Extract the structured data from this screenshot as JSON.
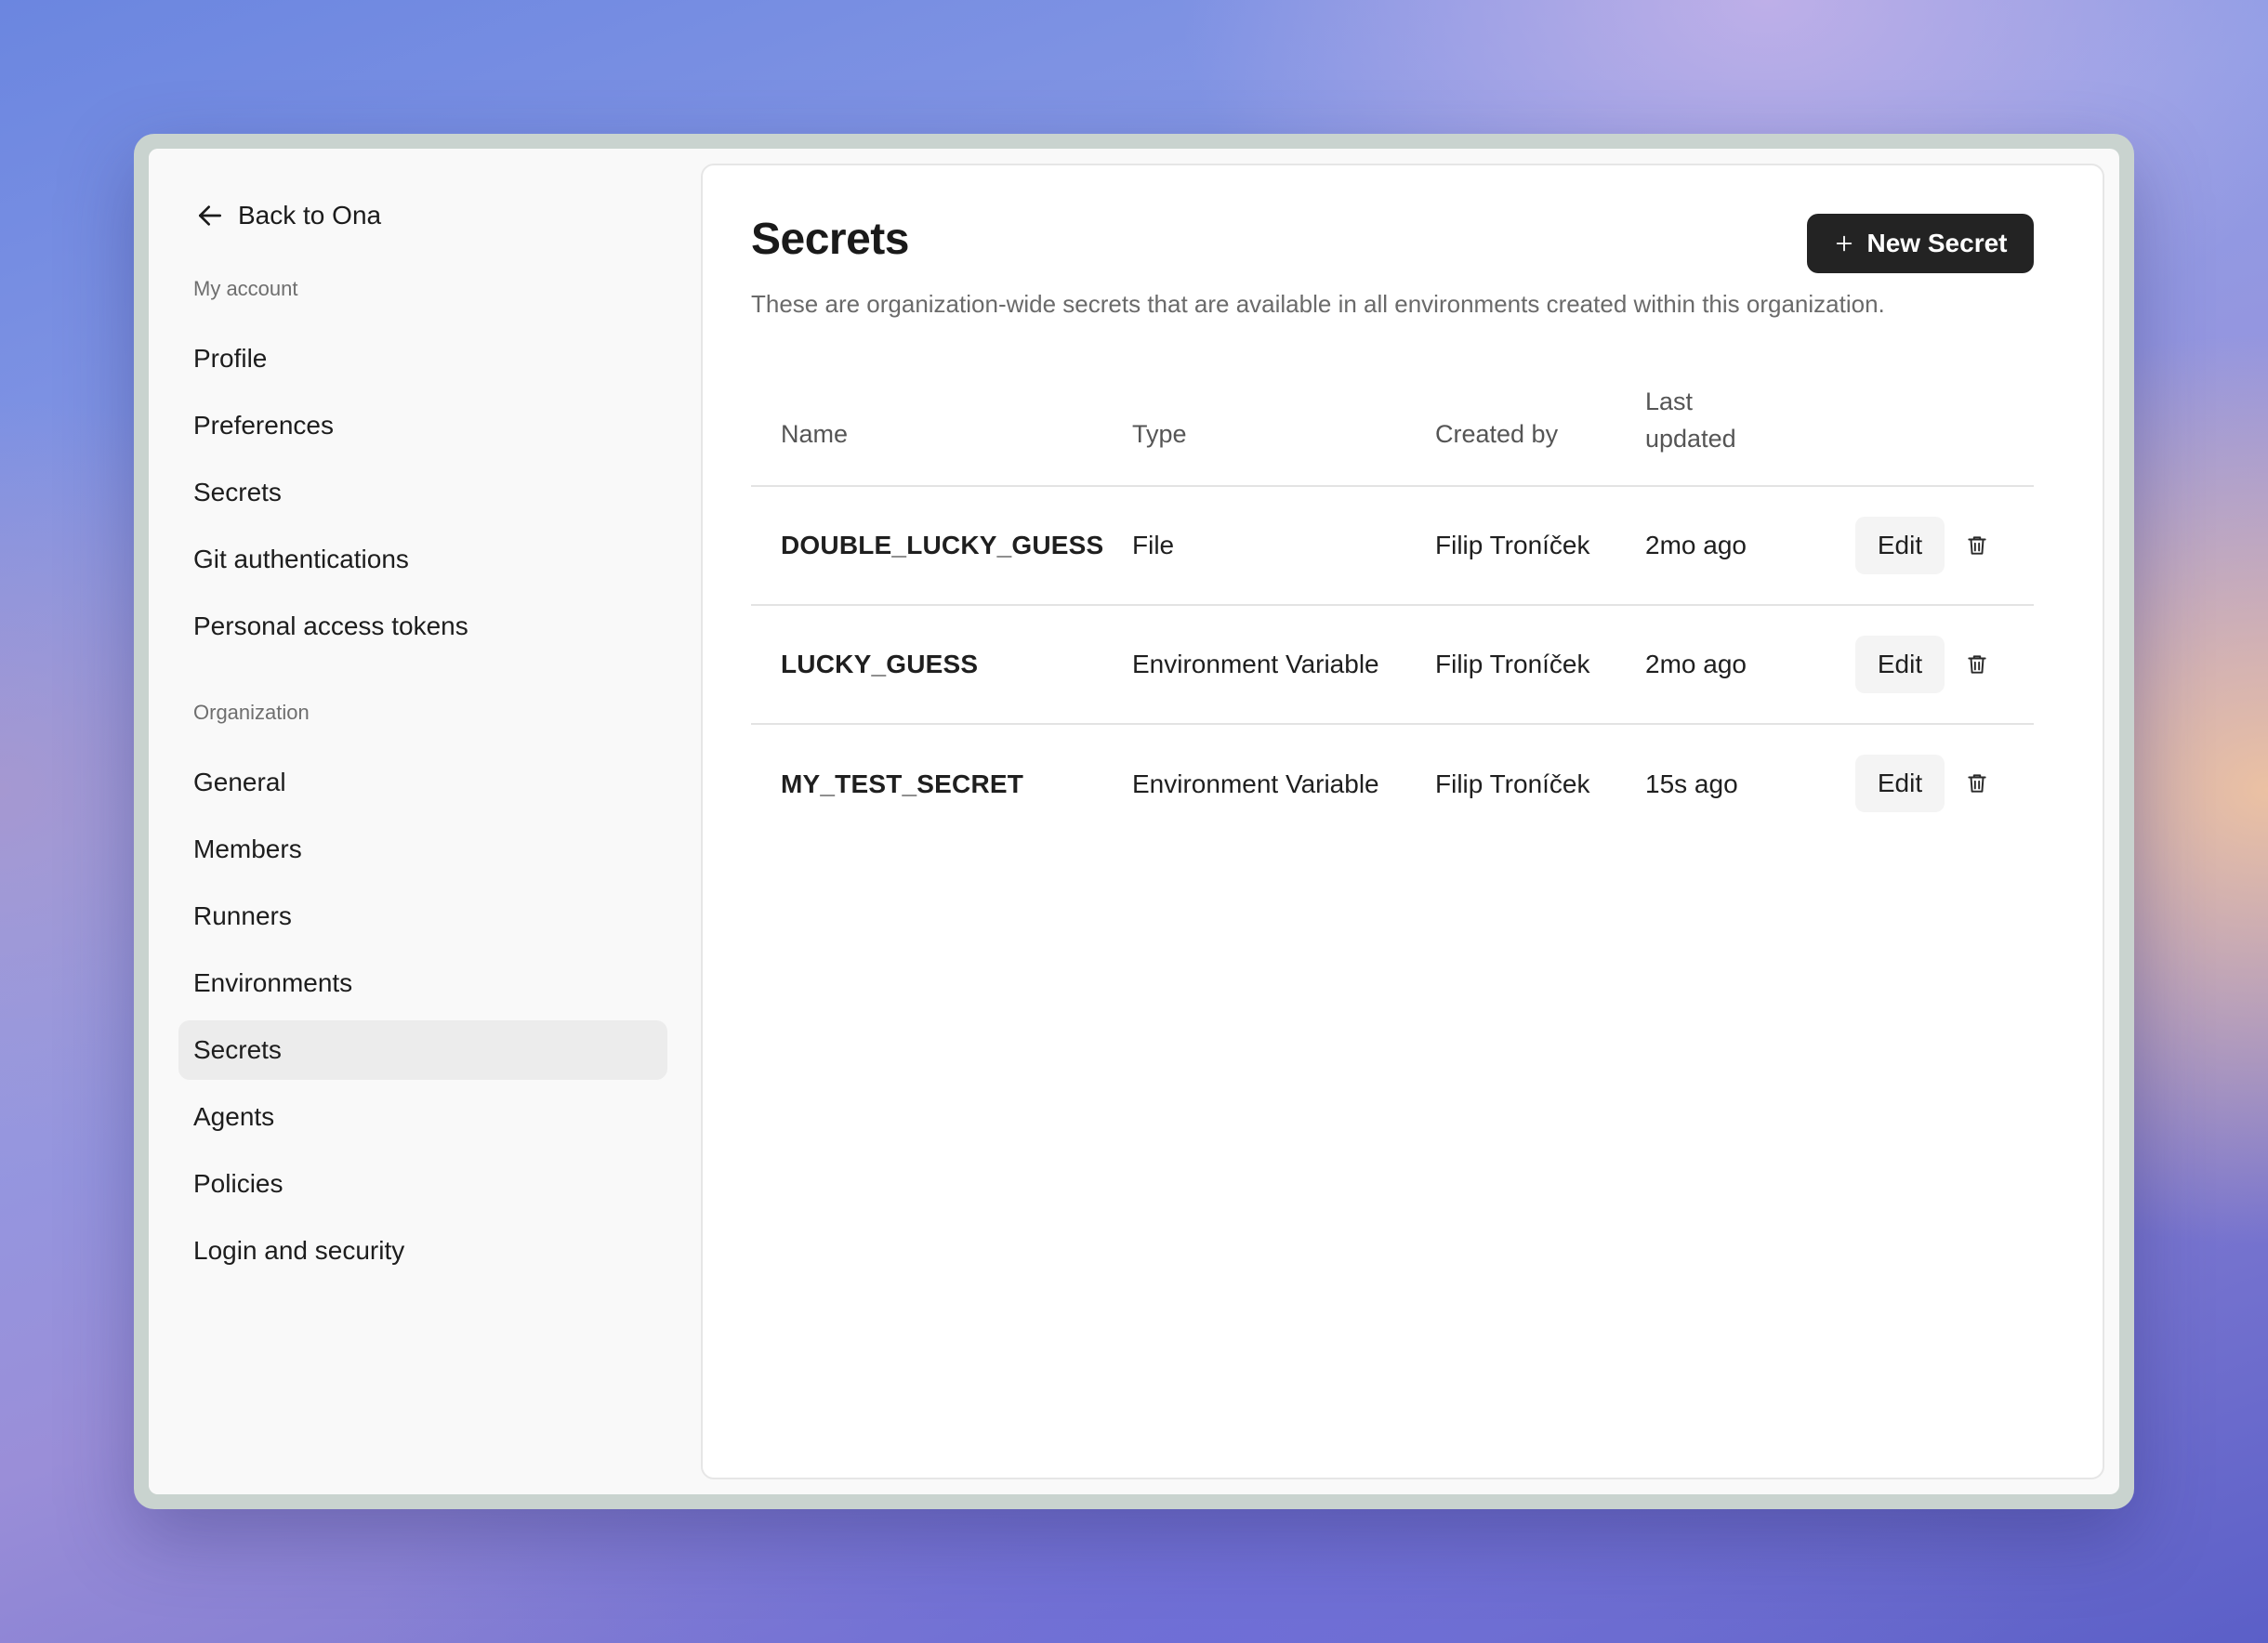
{
  "sidebar": {
    "back_label": "Back to Ona",
    "sections": [
      {
        "label": "My account",
        "items": [
          "Profile",
          "Preferences",
          "Secrets",
          "Git authentications",
          "Personal access tokens"
        ]
      },
      {
        "label": "Organization",
        "items": [
          "General",
          "Members",
          "Runners",
          "Environments",
          "Secrets",
          "Agents",
          "Policies",
          "Login and security"
        ]
      }
    ],
    "active_item": "Organization > Secrets"
  },
  "main": {
    "title": "Secrets",
    "new_button_label": "New Secret",
    "description": "These are organization-wide secrets that are available in all environments created within this organization.",
    "table": {
      "columns": [
        "Name",
        "Type",
        "Created by",
        "Last",
        "updated"
      ],
      "rows": [
        {
          "name": "DOUBLE_LUCKY_GUESS",
          "type": "File",
          "created_by": "Filip Troníček",
          "last_updated": "2mo ago",
          "edit_label": "Edit"
        },
        {
          "name": "LUCKY_GUESS",
          "type": "Environment Variable",
          "created_by": "Filip Troníček",
          "last_updated": "2mo ago",
          "edit_label": "Edit"
        },
        {
          "name": "MY_TEST_SECRET",
          "type": "Environment Variable",
          "created_by": "Filip Troníček",
          "last_updated": "15s ago",
          "edit_label": "Edit"
        }
      ]
    }
  },
  "icons": {
    "back": "arrow-left-icon",
    "new": "plus-icon",
    "delete": "trash-icon"
  },
  "colors": {
    "primary_button": "#232323",
    "active_nav": "#ececec",
    "muted_text": "#6a6a6a"
  }
}
